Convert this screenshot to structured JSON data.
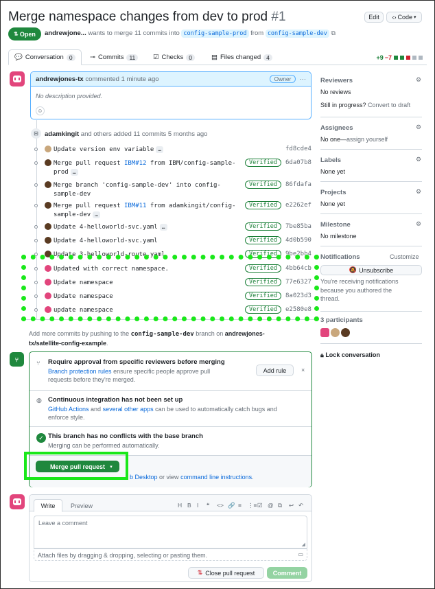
{
  "header": {
    "title": "Merge namespace changes from dev to prod",
    "number": "#1",
    "edit_label": "Edit",
    "code_label": "Code",
    "status": "Open",
    "author": "andrewjone...",
    "meta_text": "wants to merge 11 commits into",
    "base_branch": "config-sample-prod",
    "from_text": "from",
    "head_branch": "config-sample-dev"
  },
  "tabs": [
    {
      "label": "Conversation",
      "count": "0"
    },
    {
      "label": "Commits",
      "count": "11"
    },
    {
      "label": "Checks",
      "count": "0"
    },
    {
      "label": "Files changed",
      "count": "4"
    }
  ],
  "diffstat": {
    "additions": "+9",
    "deletions": "−7"
  },
  "comment": {
    "author": "andrewjones-tx",
    "action": "commented",
    "time": "1 minute ago",
    "badge": "Owner",
    "body": "No description provided."
  },
  "commits_event": {
    "actor": "adamkingit",
    "text": "and others added 11 commits",
    "time": "5 months ago"
  },
  "commits": [
    {
      "pre": "Update version env variable",
      "link": "",
      "post": "",
      "line2": "",
      "verified": false,
      "sha": "fd8cde4",
      "ellipsis": true
    },
    {
      "pre": "Merge pull request ",
      "link": "IBM#12",
      "post": " from IBM/config-sample-",
      "line2": "prod",
      "verified": true,
      "sha": "6da07b8",
      "ellipsis": true
    },
    {
      "pre": "Merge branch 'config-sample-dev' into config-",
      "link": "",
      "post": "",
      "line2": "sample-dev",
      "verified": true,
      "sha": "86fdafa",
      "ellipsis": false
    },
    {
      "pre": "Merge pull request ",
      "link": "IBM#11",
      "post": " from adamkingit/config-",
      "line2": "sample-dev",
      "verified": true,
      "sha": "e2262ef",
      "ellipsis": true
    },
    {
      "pre": "Update 4-helloworld-svc.yaml",
      "link": "",
      "post": "",
      "line2": "",
      "verified": true,
      "sha": "7be85ba",
      "ellipsis": true
    },
    {
      "pre": "Update 4-helloworld-svc.yaml",
      "link": "",
      "post": "",
      "line2": "",
      "verified": true,
      "sha": "4d0b590",
      "ellipsis": false
    },
    {
      "pre": "Update 3-helloworld-route.yaml",
      "link": "",
      "post": "",
      "line2": "",
      "verified": true,
      "sha": "9be2bb4",
      "ellipsis": false
    },
    {
      "pre": "Updated with correct namespace.",
      "link": "",
      "post": "",
      "line2": "",
      "verified": true,
      "sha": "4bb64cb",
      "ellipsis": false
    },
    {
      "pre": "Update namespace",
      "link": "",
      "post": "",
      "line2": "",
      "verified": true,
      "sha": "77e6327",
      "ellipsis": false
    },
    {
      "pre": "Update namespace",
      "link": "",
      "post": "",
      "line2": "",
      "verified": true,
      "sha": "8a023d3",
      "ellipsis": false
    },
    {
      "pre": "update namespace",
      "link": "",
      "post": "",
      "line2": "",
      "verified": true,
      "sha": "e2580e8",
      "ellipsis": false
    }
  ],
  "verified_label": "Verified",
  "add_more": {
    "pre": "Add more commits by pushing to the",
    "branch": "config-sample-dev",
    "mid": "branch on",
    "repo1": "andrewjones-",
    "repo2": "tx/satellite-config-example",
    "end": "."
  },
  "merge": {
    "approval_title": "Require approval from specific reviewers before merging",
    "approval_link": "Branch protection rules",
    "approval_text1": "ensure specific people approve pull",
    "approval_text2": "requests before they're merged.",
    "add_rule": "Add rule",
    "ci_title": "Continuous integration has not been set up",
    "ci_link1": "GitHub Actions",
    "ci_and": "and",
    "ci_link2": "several other apps",
    "ci_text1": "can be used to automatically catch bugs and",
    "ci_text2": "enforce style.",
    "conflict_title": "This branch has no conflicts with the base branch",
    "conflict_text": "Merging can be performed automatically.",
    "merge_button": "Merge pull request",
    "desktop_link": "b Desktop",
    "or_view": "or view",
    "cli_link": "command line instructions",
    "cli_end": "."
  },
  "composer": {
    "write_tab": "Write",
    "preview_tab": "Preview",
    "placeholder": "Leave a comment",
    "attach": "Attach files by dragging & dropping, selecting or pasting them.",
    "close_button": "Close pull request",
    "comment_button": "Comment",
    "toolbar": [
      "H",
      "B",
      "I",
      "❝",
      "<>",
      "🔗",
      "≡",
      "⋮≡",
      "☑",
      "@",
      "⧉",
      "↩",
      "↶",
      "⊘"
    ]
  },
  "sidebar": {
    "reviewers_title": "Reviewers",
    "reviewers_value": "No reviews",
    "still_progress": "Still in progress?",
    "convert_draft": "Convert to draft",
    "assignees_title": "Assignees",
    "assignees_value": "No one—",
    "assign_yourself": "assign yourself",
    "labels_title": "Labels",
    "labels_value": "None yet",
    "projects_title": "Projects",
    "projects_value": "None yet",
    "milestone_title": "Milestone",
    "milestone_value": "No milestone",
    "notifications_title": "Notifications",
    "customize": "Customize",
    "unsubscribe": "Unsubscribe",
    "notif_text1": "You're receiving notifications",
    "notif_text2": "because you authored the",
    "notif_text3": "thread.",
    "participants": "3 participants",
    "lock": "Lock conversation"
  },
  "colors": {
    "accent_green": "#1f883d",
    "link_blue": "#0969da",
    "highlight": "#1ae81a",
    "octo_pink": "#e2457c"
  }
}
